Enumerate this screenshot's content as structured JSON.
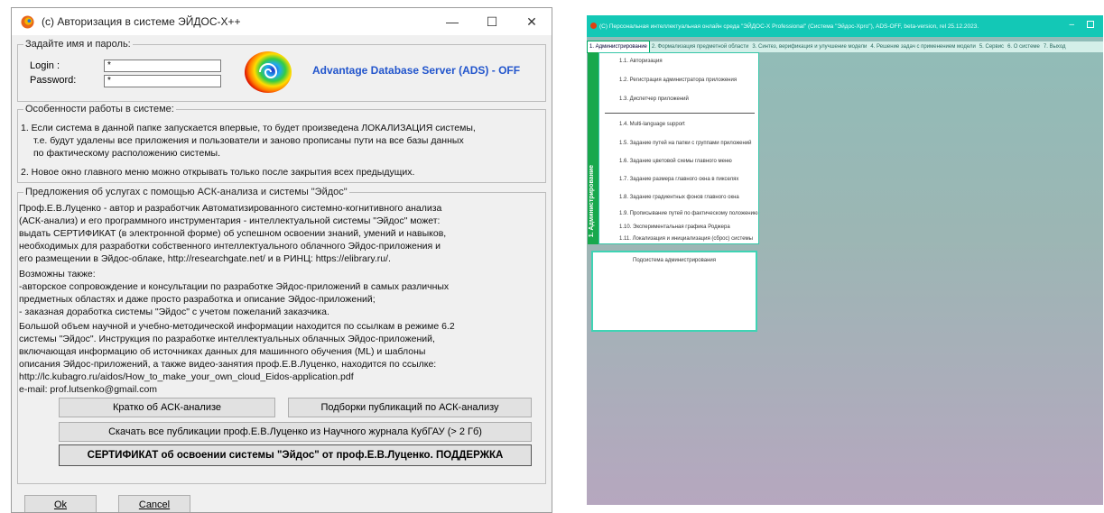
{
  "dialog": {
    "title": "(c) Авторизация в системе ЭЙДОС-X++",
    "controls": {
      "minimize": "—",
      "maximize": "☐",
      "close": "✕"
    },
    "login_group": {
      "legend": "Задайте имя и пароль:",
      "login_label": "Login  :",
      "password_label": "Password:",
      "login_value": "*",
      "password_value": "*",
      "ads_status": "Advantage Database Server (ADS) - OFF"
    },
    "features_group": {
      "legend": "Особенности работы в системе:",
      "lines": [
        "1. Если система в данной папке запускается впервые, то будет произведена ЛОКАЛИЗАЦИЯ системы,",
        "т.е. будут удалены все приложения и пользователи и заново прописаны пути на все базы данных",
        "по фактическому расположению системы.",
        "2. Новое окно главного меню можно открывать только после закрытия всех предыдущих."
      ]
    },
    "services_group": {
      "legend": "Предложения об услугах с помощью АСК-анализа и системы \"Эйдос\"",
      "lines": [
        "Проф.Е.В.Луценко - автор и разработчик Автоматизированного системно-когнитивного анализа",
        "(АСК-анализ) и его программного инструментария - интеллектуальной системы \"Эйдос\" может:",
        "выдать СЕРТИФИКАТ (в электронной форме) об успешном освоении знаний, умений и навыков,",
        "необходимых для разработки собственного интеллектуального облачного Эйдос-приложения и",
        "его размещении в Эйдос-облаке, http://researchgate.net/ и в РИНЦ: https://elibrary.ru/.",
        "Возможны также:",
        "-авторское сопровождение и консультации по разработке Эйдос-приложений в самых различных",
        "предметных областях и даже просто разработка и описание Эйдос-приложений;",
        "- заказная доработка системы \"Эйдос\" с учетом пожеланий заказчика.",
        "Большой объем научной и учебно-методической информации находится по ссылкам в режиме 6.2",
        "системы \"Эйдос\". Инструкция по разработке интеллектуальных облачных Эйдос-приложений,",
        "включающая информацию об источниках данных для машинного обучения (ML) и шаблоны",
        "описания Эйдос-приложений, а также видео-занятия проф.Е.В.Луценко, находится по ссылке:",
        "http://lc.kubagro.ru/aidos/How_to_make_your_own_cloud_Eidos-application.pdf",
        "e-mail: prof.lutsenko@gmail.com"
      ],
      "buttons": {
        "brief": "Кратко об АСК-анализе",
        "publications": "Подборки публикаций по АСК-анализу",
        "download": "Скачать все публикации проф.Е.В.Луценко из Научного журнала КубГАУ (> 2 Гб)",
        "certificate": "СЕРТИФИКАТ об освоении системы \"Эйдос\" от проф.Е.В.Луценко. ПОДДЕРЖКА"
      }
    },
    "ok_label": "Ok",
    "cancel_label": "Cancel"
  },
  "main_window": {
    "title": "(C) Персональная интеллектуальная онлайн среда \"ЭЙДОС-X Professional\" (Система \"Эйдос-Хpro\"), ADS-OFF, beta-version, rel 25.12.2023.",
    "menu": [
      "1. Администрирование",
      "2. Формализация предметной области",
      "3. Синтез, верификация и улучшение модели",
      "4. Решение задач с применением модели",
      "5. Сервис",
      "6. О системе",
      "7. Выход"
    ],
    "sidebar_label": "1. Администрирование",
    "submenu": [
      "1.1. Авторизация",
      "1.2. Регистрация администратора приложения",
      "1.3. Диспетчер приложений",
      "1.4. Multi-language support",
      "1.5. Задание путей на папки с группами приложений",
      "1.6. Задание цветовой схемы главного меню",
      "1.7. Задание размера главного окна в пикселях",
      "1.8. Задание градиентных фонов главного окна",
      "1.9. Прописывание путей по фактическому положению",
      "1.10. Экспериментальная графика Роджера",
      "1.11. Локализация и инициализация (сброс) системы"
    ],
    "panel_title": "Подсистема администрирования",
    "colors": {
      "titlebar": "#13c8b6",
      "sidebar": "#18a84c",
      "accent": "#36c6a8"
    }
  },
  "icons": {
    "app": "eidos-rainbow-spiral-icon"
  }
}
